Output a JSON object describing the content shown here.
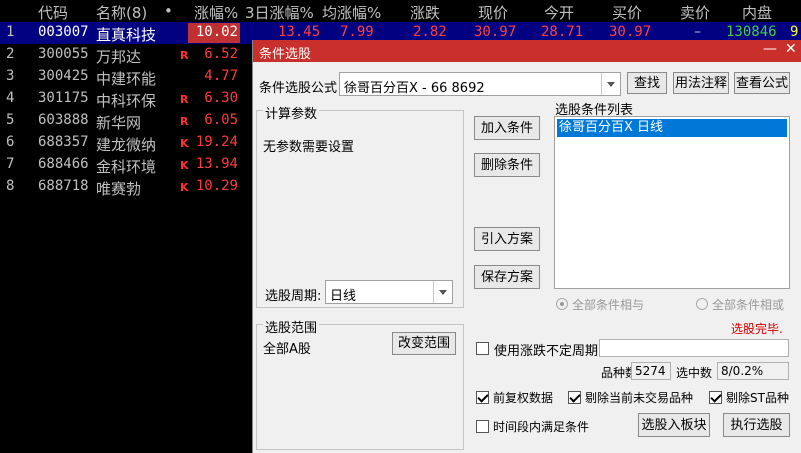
{
  "table": {
    "headers": [
      "代码",
      "名称(8)",
      "•",
      "涨幅%",
      "3日涨幅%",
      "均涨幅%",
      "涨跌",
      "现价",
      "今开",
      "买价",
      "卖价",
      "内盘"
    ],
    "rows": [
      {
        "idx": "1",
        "code": "003007",
        "name": "直真科技",
        "flag": "",
        "pct": "10.02"
      },
      {
        "idx": "2",
        "code": "300055",
        "name": "万邦达",
        "flag": "R",
        "pct": "6.52"
      },
      {
        "idx": "3",
        "code": "300425",
        "name": "中建环能",
        "flag": "",
        "pct": "4.77"
      },
      {
        "idx": "4",
        "code": "301175",
        "name": "中科环保",
        "flag": "R",
        "pct": "6.30"
      },
      {
        "idx": "5",
        "code": "603888",
        "name": "新华网",
        "flag": "R",
        "pct": "6.05"
      },
      {
        "idx": "6",
        "code": "688357",
        "name": "建龙微纳",
        "flag": "K",
        "pct": "19.24"
      },
      {
        "idx": "7",
        "code": "688466",
        "name": "金科环境",
        "flag": "K",
        "pct": "13.94"
      },
      {
        "idx": "8",
        "code": "688718",
        "name": "唯赛勃",
        "flag": "K",
        "pct": "10.29"
      }
    ],
    "row1_extra": {
      "d3": "13.45",
      "avg": "7.99",
      "chg": "2.82",
      "price": "30.97",
      "open": "28.71",
      "bid": "30.97",
      "ask": "–",
      "inner": "130846",
      "more": "9"
    },
    "edge_marks": [
      "2",
      "2",
      "1",
      "2",
      "1",
      "2",
      "8"
    ]
  },
  "dialog": {
    "title": "条件选股",
    "minimize": "—",
    "close": "✕",
    "formula_label": "条件选股公式",
    "formula_value": "徐哥百分百X  -  66  8692",
    "find_btn": "查找",
    "usage_btn": "用法注释",
    "view_btn": "查看公式",
    "params_title": "计算参数",
    "params_text": "无参数需要设置",
    "period_label": "选股周期:",
    "period_value": "日线",
    "add_btn": "加入条件",
    "del_btn": "删除条件",
    "import_btn": "引入方案",
    "save_btn": "保存方案",
    "list_title": "选股条件列表",
    "list_items": [
      "徐哥百分百X  日线"
    ],
    "radio_and": "全部条件相与",
    "radio_or": "全部条件相或",
    "status": "选股完毕.",
    "scope_title": "选股范围",
    "scope_value": "全部A股",
    "scope_btn": "改变范围",
    "var_period_label": "使用涨跌不定周期",
    "count_label": "品种数",
    "count_value": "5274",
    "selected_label": "选中数",
    "selected_value": "8/0.2%",
    "opt_adj": "前复权数据",
    "opt_untraded": "剔除当前未交易品种",
    "opt_st": "剔除ST品种",
    "opt_period": "时间段内满足条件",
    "to_block_btn": "选股入板块",
    "exec_btn": "执行选股"
  },
  "colors": {
    "title_bar": "#c9302c",
    "row_highlight": "#000080",
    "up": "#ff3b3b",
    "status": "#d00000"
  }
}
